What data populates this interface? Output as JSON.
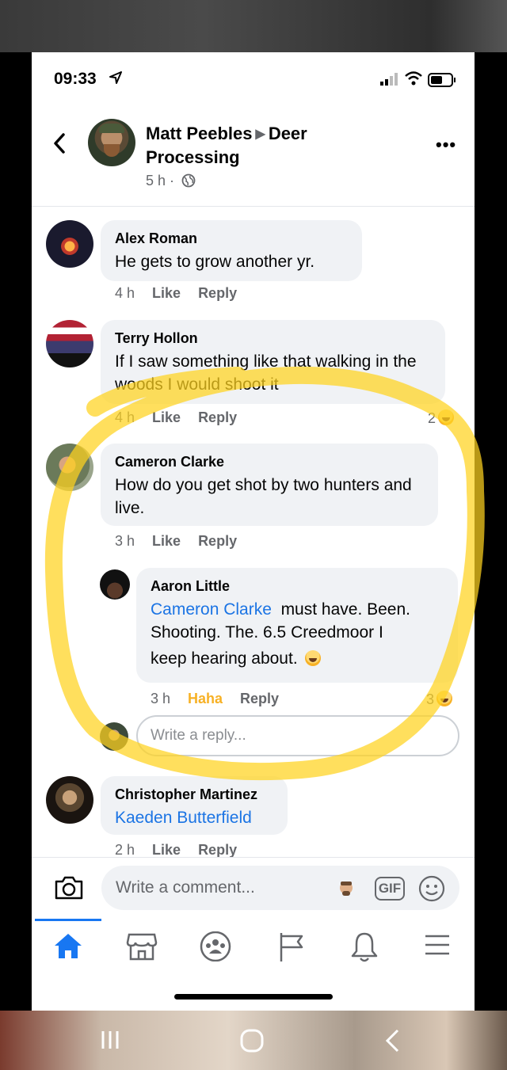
{
  "status_bar": {
    "time": "09:33"
  },
  "post": {
    "author": "Matt Peebles",
    "group": "Deer Processing",
    "time": "5 h",
    "separator": "·"
  },
  "comments": [
    {
      "name": "Alex Roman",
      "text": "He gets to grow another yr.",
      "time": "4 h",
      "like": "Like",
      "reply": "Reply"
    },
    {
      "name": "Terry Hollon",
      "text": "If I saw something like that walking in the woods I would shoot it",
      "time": "4 h",
      "like": "Like",
      "reply": "Reply",
      "reactions": "2"
    },
    {
      "name": "Cameron Clarke",
      "text": "How do you get shot by two hunters and live.",
      "time": "3 h",
      "like": "Like",
      "reply": "Reply"
    },
    {
      "name": "Christopher Martinez",
      "mention": "Kaeden Butterfield",
      "time": "2 h",
      "like": "Like",
      "reply": "Reply"
    }
  ],
  "nested_reply": {
    "name": "Aaron Little",
    "mention": "Cameron Clarke",
    "text_line1": "must have. Been.",
    "text_line2": "Shooting. The. 6.5 Creedmoor  I",
    "text_line3": "keep hearing  about.",
    "time": "3 h",
    "reaction_label": "Haha",
    "reply": "Reply",
    "reactions": "3"
  },
  "reply_box": {
    "placeholder": "Write a reply..."
  },
  "comment_bar": {
    "placeholder": "Write a comment...",
    "gif": "GIF"
  },
  "tabs": [
    "home-icon",
    "marketplace-icon",
    "groups-icon",
    "pages-flag-icon",
    "notifications-bell-icon",
    "menu-icon"
  ],
  "colors": {
    "accent": "#1877f2",
    "mention": "#1b74e4",
    "haha": "#f7b125",
    "highlight": "#ffd21f"
  }
}
